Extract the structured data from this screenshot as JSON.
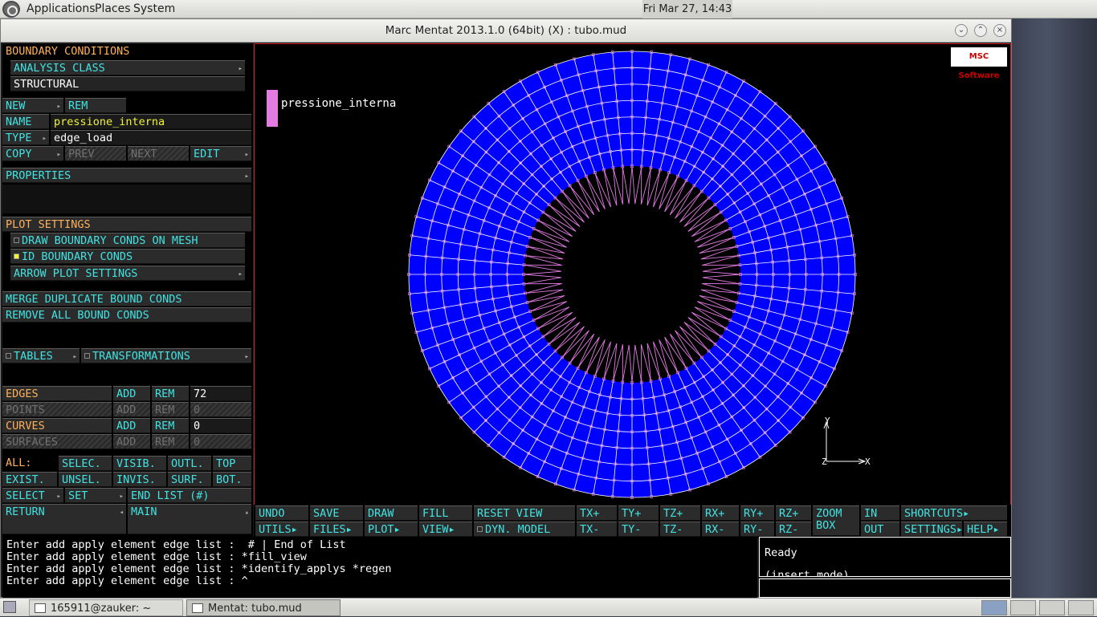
{
  "topbar": {
    "menus": [
      "Applications",
      "Places",
      "System"
    ],
    "clock": "Fri Mar 27, 14:43"
  },
  "window": {
    "title": "Marc Mentat 2013.1.0 (64bit) (X) : tubo.mud"
  },
  "panel": {
    "header": "BOUNDARY CONDITIONS",
    "analysis_class": "ANALYSIS CLASS",
    "analysis_value": "STRUCTURAL",
    "new": "NEW",
    "rem": "REM",
    "name_label": "NAME",
    "name_value": "pressione_interna",
    "type_label": "TYPE",
    "type_value": "edge_load",
    "copy": "COPY",
    "prev": "PREV",
    "next": "NEXT",
    "edit": "EDIT",
    "properties": "PROPERTIES",
    "plot_settings": "PLOT SETTINGS",
    "draw_bc": "DRAW BOUNDARY CONDS ON MESH",
    "id_bc": "ID BOUNDARY CONDS",
    "arrow_plot": "ARROW PLOT SETTINGS",
    "merge": "MERGE DUPLICATE BOUND CONDS",
    "remove_all": "REMOVE ALL BOUND CONDS",
    "tables": "TABLES",
    "transformations": "TRANSFORMATIONS",
    "edges": "EDGES",
    "points": "POINTS",
    "curves": "CURVES",
    "surfaces": "SURFACES",
    "add": "ADD",
    "remx": "REM",
    "edges_count": "72",
    "points_count": "0",
    "curves_count": "0",
    "surfaces_count": "0",
    "all": "ALL:",
    "selec": "SELEC.",
    "visib": "VISIB.",
    "outl": "OUTL.",
    "top": "TOP",
    "exist": "EXIST.",
    "unsel": "UNSEL.",
    "invis": "INVIS.",
    "surf": "SURF.",
    "bot": "BOT.",
    "select": "SELECT",
    "set": "SET",
    "endlist": "END LIST (#)",
    "return": "RETURN",
    "main": "MAIN"
  },
  "viewport": {
    "legend": "pressione_interna",
    "logo": "MSC Software",
    "axis_x": "X",
    "axis_y": "Y",
    "axis_z": "Z",
    "page": "1",
    "mesh_color": "#0000ff",
    "edge_color": "#e37be3"
  },
  "buttons": {
    "undo": "UNDO",
    "save": "SAVE",
    "draw": "DRAW",
    "fill": "FILL",
    "reset_view": "RESET VIEW",
    "txp": "TX+",
    "typ": "TY+",
    "tzp": "TZ+",
    "rxp": "RX+",
    "ryp": "RY+",
    "rzp": "RZ+",
    "zoom_box": "ZOOM BOX",
    "in": "IN",
    "shortcuts": "SHORTCUTS",
    "utils": "UTILS",
    "files": "FILES",
    "plot": "PLOT",
    "view": "VIEW",
    "dyn_model": "DYN. MODEL",
    "txm": "TX-",
    "tym": "TY-",
    "tzm": "TZ-",
    "rxm": "RX-",
    "rym": "RY-",
    "rzm": "RZ-",
    "out": "OUT",
    "settings": "SETTINGS",
    "help": "HELP"
  },
  "cmd": {
    "l1": "Enter add apply element edge list :  # | End of List",
    "l2": "Enter add apply element edge list : *fill_view",
    "l3": "Enter add apply element edge list : *identify_applys *regen",
    "l4": "Enter add apply element edge list :"
  },
  "status": {
    "ready": "Ready",
    "mode": "(insert mode)"
  },
  "taskbar": {
    "task1": "165911@zauker: ~",
    "task2": "Mentat: tubo.mud"
  }
}
